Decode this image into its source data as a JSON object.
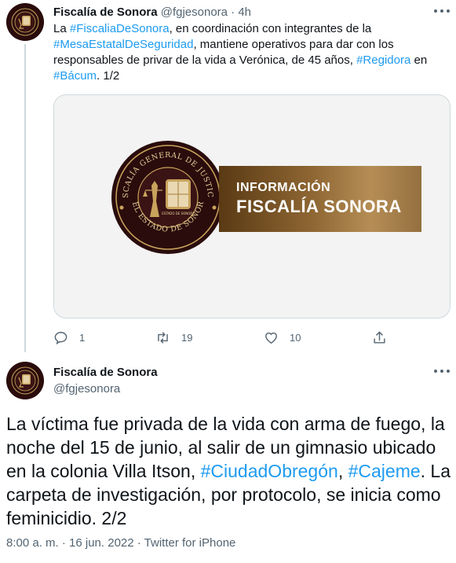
{
  "tweet1": {
    "author_name": "Fiscalía de Sonora",
    "handle": "@fgjesonora",
    "separator": "·",
    "time": "4h",
    "text": {
      "p1": "La ",
      "tag1": "#FiscaliaDeSonora",
      "p2": ", en coordinación con integrantes de la ",
      "tag2": "#MesaEstatalDeSeguridad",
      "p3": ", mantiene operativos para dar con los responsables de privar de la vida a Verónica, de 45 años, ",
      "tag3": "#Regidora",
      "p4": " en ",
      "tag4": "#Bácum",
      "p5": ". 1/2"
    },
    "media": {
      "seal_top_text": "FISCALÍA GENERAL DE JUSTICIA",
      "seal_bottom_text": "DEL ESTADO DE SONORA",
      "seal_shield_text": "ESTADO DE SONORA",
      "banner_line1": "INFORMACIÓN",
      "banner_line2": "FISCALÍA SONORA"
    },
    "actions": {
      "reply_count": "1",
      "retweet_count": "19",
      "like_count": "10"
    }
  },
  "tweet2": {
    "author_name": "Fiscalía de Sonora",
    "handle": "@fgjesonora",
    "text": {
      "p1": "La víctima fue privada de la vida con arma de fuego, la noche del 15 de junio, al salir de un gimnasio ubicado en la colonia Villa Itson, ",
      "tag1": "#CiudadObregón",
      "p2": ", ",
      "tag2": "#Cajeme",
      "p3": ". La carpeta  de investigación, por protocolo, se inicia como feminicidio. 2/2"
    },
    "meta": "8:00 a. m. · 16 jun. 2022 · Twitter for iPhone"
  },
  "colors": {
    "link": "#1d9bf0",
    "secondary_text": "#536471",
    "primary_text": "#0f1419",
    "avatar_bg": "#2a0c0c",
    "banner_gold": "#8d6532"
  },
  "icons": [
    "reply-icon",
    "retweet-icon",
    "like-icon",
    "share-icon",
    "more-icon"
  ]
}
